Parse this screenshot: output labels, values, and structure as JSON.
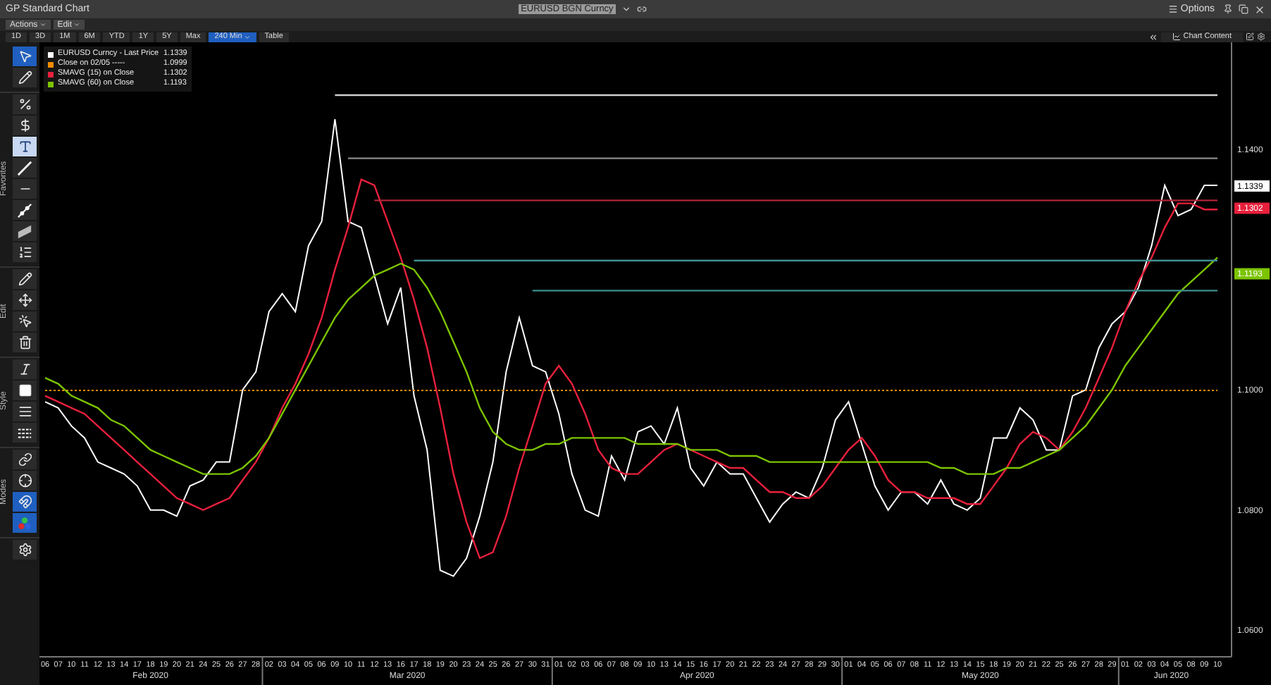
{
  "window": {
    "title": "GP Standard Chart",
    "ticker": "EURUSD BGN Curncy",
    "options": "Options"
  },
  "menus": [
    "Actions",
    "Edit"
  ],
  "periods": [
    {
      "label": "1D",
      "selected": false,
      "kind": "plain"
    },
    {
      "label": "3D",
      "selected": false,
      "kind": "plain"
    },
    {
      "label": "1M",
      "selected": false,
      "kind": "plain"
    },
    {
      "label": "6M",
      "selected": false,
      "kind": "plain"
    },
    {
      "label": "YTD",
      "selected": false,
      "kind": "plain"
    },
    {
      "label": "1Y",
      "selected": false,
      "kind": "plain"
    },
    {
      "label": "5Y",
      "selected": false,
      "kind": "plain"
    },
    {
      "label": "Max",
      "selected": false,
      "kind": "plain"
    },
    {
      "label": "240 Min",
      "selected": true,
      "kind": "dropdown"
    },
    {
      "label": "Table",
      "selected": false,
      "kind": "plain"
    }
  ],
  "chart_content": "Chart Content",
  "toolbar": [
    {
      "tools": [
        {
          "kind": "cursor",
          "selected": true
        },
        {
          "kind": "pencil",
          "selected": false
        }
      ]
    },
    {
      "label": "Favorites",
      "tools": [
        {
          "kind": "percent",
          "selected": false
        },
        {
          "kind": "dollar",
          "selected": false
        },
        {
          "kind": "text",
          "selected": true
        },
        {
          "kind": "trend",
          "selected": false
        },
        {
          "kind": "hline",
          "selected": false
        },
        {
          "kind": "ray",
          "selected": false
        },
        {
          "kind": "channel",
          "selected": false
        },
        {
          "kind": "list",
          "selected": false
        }
      ]
    },
    {
      "label": "Edit",
      "tools": [
        {
          "kind": "pencil",
          "selected": false
        },
        {
          "kind": "move",
          "selected": false
        },
        {
          "kind": "select",
          "selected": false
        },
        {
          "kind": "delete",
          "selected": false
        }
      ]
    },
    {
      "label": "Style",
      "tools": [
        {
          "kind": "font",
          "selected": false
        },
        {
          "kind": "fill",
          "selected": false
        },
        {
          "kind": "width",
          "selected": false
        },
        {
          "kind": "dashes",
          "selected": false
        }
      ]
    },
    {
      "label": "Modes",
      "tools": [
        {
          "kind": "link",
          "selected": false
        },
        {
          "kind": "crosshair",
          "selected": false
        },
        {
          "kind": "magnet",
          "selected": true
        },
        {
          "kind": "colors",
          "selected": true
        }
      ]
    },
    {
      "tools": [
        {
          "kind": "settings",
          "selected": false
        }
      ]
    }
  ],
  "legend_values": [
    "1.1339",
    "1.0999",
    "1.1302",
    "1.1193"
  ],
  "price_tags": [
    {
      "label": "1.1339",
      "color": "#ffffff"
    },
    {
      "label": "1.1302",
      "color": "#e8203c"
    },
    {
      "label": "1.1193",
      "color": "#7cc400"
    }
  ],
  "month_labels": [
    "Feb 2020",
    "Mar 2020",
    "Apr 2020",
    "May 2020",
    "Jun 2020"
  ],
  "chart_data": {
    "type": "line",
    "ylim": [
      1.0556,
      1.1578
    ],
    "yticks": [
      {
        "value": 1.06,
        "label": "1.0600"
      },
      {
        "value": 1.08,
        "label": "1.0800"
      },
      {
        "value": 1.1,
        "label": "1.1000"
      },
      {
        "value": 1.14,
        "label": "1.1400"
      }
    ],
    "categories": [
      "06",
      "07",
      "10",
      "11",
      "12",
      "13",
      "14",
      "17",
      "18",
      "19",
      "20",
      "21",
      "24",
      "25",
      "26",
      "27",
      "28",
      "02",
      "03",
      "04",
      "05",
      "06",
      "09",
      "10",
      "11",
      "12",
      "13",
      "16",
      "17",
      "18",
      "19",
      "20",
      "23",
      "24",
      "25",
      "26",
      "27",
      "30",
      "31",
      "01",
      "02",
      "03",
      "06",
      "07",
      "08",
      "09",
      "10",
      "13",
      "14",
      "15",
      "16",
      "17",
      "20",
      "21",
      "22",
      "23",
      "24",
      "27",
      "28",
      "29",
      "30",
      "01",
      "04",
      "05",
      "06",
      "07",
      "08",
      "11",
      "12",
      "13",
      "14",
      "15",
      "18",
      "19",
      "20",
      "21",
      "22",
      "25",
      "26",
      "27",
      "28",
      "29",
      "01",
      "02",
      "03",
      "04",
      "05",
      "08",
      "09",
      "10"
    ],
    "series": [
      {
        "name": "EURUSD Curncy - Last Price",
        "color": "#ffffff",
        "values": [
          1.098,
          1.097,
          1.094,
          1.092,
          1.088,
          1.087,
          1.086,
          1.084,
          1.08,
          1.08,
          1.079,
          1.084,
          1.085,
          1.088,
          1.088,
          1.1,
          1.103,
          1.113,
          1.116,
          1.113,
          1.124,
          1.128,
          1.145,
          1.128,
          1.127,
          1.119,
          1.111,
          1.117,
          1.099,
          1.09,
          1.07,
          1.069,
          1.072,
          1.079,
          1.088,
          1.103,
          1.112,
          1.104,
          1.103,
          1.096,
          1.086,
          1.08,
          1.079,
          1.089,
          1.085,
          1.093,
          1.094,
          1.091,
          1.097,
          1.087,
          1.084,
          1.088,
          1.086,
          1.086,
          1.082,
          1.078,
          1.081,
          1.083,
          1.082,
          1.087,
          1.095,
          1.098,
          1.091,
          1.084,
          1.08,
          1.083,
          1.083,
          1.081,
          1.085,
          1.081,
          1.08,
          1.082,
          1.092,
          1.092,
          1.097,
          1.095,
          1.09,
          1.09,
          1.099,
          1.1,
          1.107,
          1.111,
          1.113,
          1.117,
          1.124,
          1.134,
          1.129,
          1.13,
          1.134,
          1.134
        ]
      },
      {
        "name": "Close on 02/05 -----",
        "color": "#f08c00",
        "line_style": "dotted",
        "values": [
          1.0999,
          1.0999,
          1.0999,
          1.0999,
          1.0999,
          1.0999,
          1.0999,
          1.0999,
          1.0999,
          1.0999,
          1.0999,
          1.0999,
          1.0999,
          1.0999,
          1.0999,
          1.0999,
          1.0999,
          1.0999,
          1.0999,
          1.0999,
          1.0999,
          1.0999,
          1.0999,
          1.0999,
          1.0999,
          1.0999,
          1.0999,
          1.0999,
          1.0999,
          1.0999,
          1.0999,
          1.0999,
          1.0999,
          1.0999,
          1.0999,
          1.0999,
          1.0999,
          1.0999,
          1.0999,
          1.0999,
          1.0999,
          1.0999,
          1.0999,
          1.0999,
          1.0999,
          1.0999,
          1.0999,
          1.0999,
          1.0999,
          1.0999,
          1.0999,
          1.0999,
          1.0999,
          1.0999,
          1.0999,
          1.0999,
          1.0999,
          1.0999,
          1.0999,
          1.0999,
          1.0999,
          1.0999,
          1.0999,
          1.0999,
          1.0999,
          1.0999,
          1.0999,
          1.0999,
          1.0999,
          1.0999,
          1.0999,
          1.0999,
          1.0999,
          1.0999,
          1.0999,
          1.0999,
          1.0999,
          1.0999,
          1.0999,
          1.0999,
          1.0999,
          1.0999,
          1.0999,
          1.0999,
          1.0999,
          1.0999,
          1.0999,
          1.0999,
          1.0999,
          1.0999
        ]
      },
      {
        "name": "SMAVG (15)  on Close",
        "color": "#e8203c",
        "values": [
          1.099,
          1.098,
          1.097,
          1.096,
          1.094,
          1.092,
          1.09,
          1.088,
          1.086,
          1.084,
          1.082,
          1.081,
          1.08,
          1.081,
          1.082,
          1.085,
          1.088,
          1.092,
          1.097,
          1.101,
          1.106,
          1.112,
          1.12,
          1.127,
          1.135,
          1.134,
          1.128,
          1.122,
          1.115,
          1.107,
          1.097,
          1.086,
          1.078,
          1.072,
          1.073,
          1.079,
          1.087,
          1.094,
          1.101,
          1.104,
          1.101,
          1.096,
          1.09,
          1.087,
          1.086,
          1.086,
          1.088,
          1.09,
          1.091,
          1.09,
          1.089,
          1.088,
          1.087,
          1.087,
          1.085,
          1.083,
          1.083,
          1.082,
          1.082,
          1.084,
          1.087,
          1.09,
          1.092,
          1.089,
          1.085,
          1.083,
          1.083,
          1.082,
          1.082,
          1.082,
          1.081,
          1.081,
          1.084,
          1.087,
          1.091,
          1.093,
          1.092,
          1.09,
          1.093,
          1.097,
          1.102,
          1.107,
          1.113,
          1.118,
          1.122,
          1.127,
          1.131,
          1.131,
          1.13,
          1.13
        ]
      },
      {
        "name": "SMAVG (60)  on Close",
        "color": "#7cc400",
        "values": [
          1.102,
          1.101,
          1.099,
          1.098,
          1.097,
          1.095,
          1.094,
          1.092,
          1.09,
          1.089,
          1.088,
          1.087,
          1.086,
          1.086,
          1.086,
          1.087,
          1.089,
          1.092,
          1.096,
          1.1,
          1.104,
          1.108,
          1.112,
          1.115,
          1.117,
          1.119,
          1.12,
          1.121,
          1.12,
          1.117,
          1.113,
          1.108,
          1.103,
          1.097,
          1.093,
          1.091,
          1.09,
          1.09,
          1.091,
          1.091,
          1.092,
          1.092,
          1.092,
          1.092,
          1.092,
          1.091,
          1.091,
          1.091,
          1.091,
          1.09,
          1.09,
          1.09,
          1.089,
          1.089,
          1.089,
          1.088,
          1.088,
          1.088,
          1.088,
          1.088,
          1.088,
          1.088,
          1.088,
          1.088,
          1.088,
          1.088,
          1.088,
          1.088,
          1.087,
          1.087,
          1.086,
          1.086,
          1.086,
          1.087,
          1.087,
          1.088,
          1.089,
          1.09,
          1.092,
          1.094,
          1.097,
          1.1,
          1.104,
          1.107,
          1.11,
          1.113,
          1.116,
          1.118,
          1.12,
          1.122
        ]
      },
      {
        "color": "#cfcfcf",
        "values": [
          null,
          null,
          null,
          null,
          null,
          null,
          null,
          null,
          null,
          null,
          null,
          null,
          null,
          null,
          null,
          null,
          null,
          null,
          null,
          null,
          null,
          null,
          1.149,
          1.149,
          1.149,
          1.149,
          1.149,
          1.149,
          1.149,
          1.149,
          1.149,
          1.149,
          1.149,
          1.149,
          1.149,
          1.149,
          1.149,
          1.149,
          1.149,
          1.149,
          1.149,
          1.149,
          1.149,
          1.149,
          1.149,
          1.149,
          1.149,
          1.149,
          1.149,
          1.149,
          1.149,
          1.149,
          1.149,
          1.149,
          1.149,
          1.149,
          1.149,
          1.149,
          1.149,
          1.149,
          1.149,
          1.149,
          1.149,
          1.149,
          1.149,
          1.149,
          1.149,
          1.149,
          1.149,
          1.149,
          1.149,
          1.149,
          1.149,
          1.149,
          1.149,
          1.149,
          1.149,
          1.149,
          1.149,
          1.149,
          1.149,
          1.149,
          1.149,
          1.149,
          1.149,
          1.149,
          1.149,
          1.149,
          1.149,
          1.149
        ]
      },
      {
        "color": "#8a8a8a",
        "values": [
          null,
          null,
          null,
          null,
          null,
          null,
          null,
          null,
          null,
          null,
          null,
          null,
          null,
          null,
          null,
          null,
          null,
          null,
          null,
          null,
          null,
          null,
          null,
          1.1385,
          1.1385,
          1.1385,
          1.1385,
          1.1385,
          1.1385,
          1.1385,
          1.1385,
          1.1385,
          1.1385,
          1.1385,
          1.1385,
          1.1385,
          1.1385,
          1.1385,
          1.1385,
          1.1385,
          1.1385,
          1.1385,
          1.1385,
          1.1385,
          1.1385,
          1.1385,
          1.1385,
          1.1385,
          1.1385,
          1.1385,
          1.1385,
          1.1385,
          1.1385,
          1.1385,
          1.1385,
          1.1385,
          1.1385,
          1.1385,
          1.1385,
          1.1385,
          1.1385,
          1.1385,
          1.1385,
          1.1385,
          1.1385,
          1.1385,
          1.1385,
          1.1385,
          1.1385,
          1.1385,
          1.1385,
          1.1385,
          1.1385,
          1.1385,
          1.1385,
          1.1385,
          1.1385,
          1.1385,
          1.1385,
          1.1385,
          1.1385,
          1.1385,
          1.1385,
          1.1385,
          1.1385,
          1.1385,
          1.1385,
          1.1385,
          1.1385,
          1.1385
        ]
      },
      {
        "color": "#b0243a",
        "values": [
          null,
          null,
          null,
          null,
          null,
          null,
          null,
          null,
          null,
          null,
          null,
          null,
          null,
          null,
          null,
          null,
          null,
          null,
          null,
          null,
          null,
          null,
          null,
          null,
          null,
          1.1315,
          1.1315,
          1.1315,
          1.1315,
          1.1315,
          1.1315,
          1.1315,
          1.1315,
          1.1315,
          1.1315,
          1.1315,
          1.1315,
          1.1315,
          1.1315,
          1.1315,
          1.1315,
          1.1315,
          1.1315,
          1.1315,
          1.1315,
          1.1315,
          1.1315,
          1.1315,
          1.1315,
          1.1315,
          1.1315,
          1.1315,
          1.1315,
          1.1315,
          1.1315,
          1.1315,
          1.1315,
          1.1315,
          1.1315,
          1.1315,
          1.1315,
          1.1315,
          1.1315,
          1.1315,
          1.1315,
          1.1315,
          1.1315,
          1.1315,
          1.1315,
          1.1315,
          1.1315,
          1.1315,
          1.1315,
          1.1315,
          1.1315,
          1.1315,
          1.1315,
          1.1315,
          1.1315,
          1.1315,
          1.1315,
          1.1315,
          1.1315,
          1.1315,
          1.1315,
          1.1315,
          1.1315,
          1.1315,
          1.1315,
          1.1315
        ]
      },
      {
        "color": "#3f9090",
        "values": [
          null,
          null,
          null,
          null,
          null,
          null,
          null,
          null,
          null,
          null,
          null,
          null,
          null,
          null,
          null,
          null,
          null,
          null,
          null,
          null,
          null,
          null,
          null,
          null,
          null,
          null,
          null,
          null,
          1.1215,
          1.1215,
          1.1215,
          1.1215,
          1.1215,
          1.1215,
          1.1215,
          1.1215,
          1.1215,
          1.1215,
          1.1215,
          1.1215,
          1.1215,
          1.1215,
          1.1215,
          1.1215,
          1.1215,
          1.1215,
          1.1215,
          1.1215,
          1.1215,
          1.1215,
          1.1215,
          1.1215,
          1.1215,
          1.1215,
          1.1215,
          1.1215,
          1.1215,
          1.1215,
          1.1215,
          1.1215,
          1.1215,
          1.1215,
          1.1215,
          1.1215,
          1.1215,
          1.1215,
          1.1215,
          1.1215,
          1.1215,
          1.1215,
          1.1215,
          1.1215,
          1.1215,
          1.1215,
          1.1215,
          1.1215,
          1.1215,
          1.1215,
          1.1215,
          1.1215,
          1.1215,
          1.1215,
          1.1215,
          1.1215,
          1.1215,
          1.1215,
          1.1215,
          1.1215,
          1.1215,
          1.1215
        ]
      },
      {
        "color": "#3f9090",
        "values": [
          null,
          null,
          null,
          null,
          null,
          null,
          null,
          null,
          null,
          null,
          null,
          null,
          null,
          null,
          null,
          null,
          null,
          null,
          null,
          null,
          null,
          null,
          null,
          null,
          null,
          null,
          null,
          null,
          null,
          null,
          null,
          null,
          null,
          null,
          null,
          null,
          null,
          1.1165,
          1.1165,
          1.1165,
          1.1165,
          1.1165,
          1.1165,
          1.1165,
          1.1165,
          1.1165,
          1.1165,
          1.1165,
          1.1165,
          1.1165,
          1.1165,
          1.1165,
          1.1165,
          1.1165,
          1.1165,
          1.1165,
          1.1165,
          1.1165,
          1.1165,
          1.1165,
          1.1165,
          1.1165,
          1.1165,
          1.1165,
          1.1165,
          1.1165,
          1.1165,
          1.1165,
          1.1165,
          1.1165,
          1.1165,
          1.1165,
          1.1165,
          1.1165,
          1.1165,
          1.1165,
          1.1165,
          1.1165,
          1.1165,
          1.1165,
          1.1165,
          1.1165,
          1.1165,
          1.1165,
          1.1165,
          1.1165,
          1.1165,
          1.1165,
          1.1165,
          1.1165
        ]
      }
    ]
  }
}
